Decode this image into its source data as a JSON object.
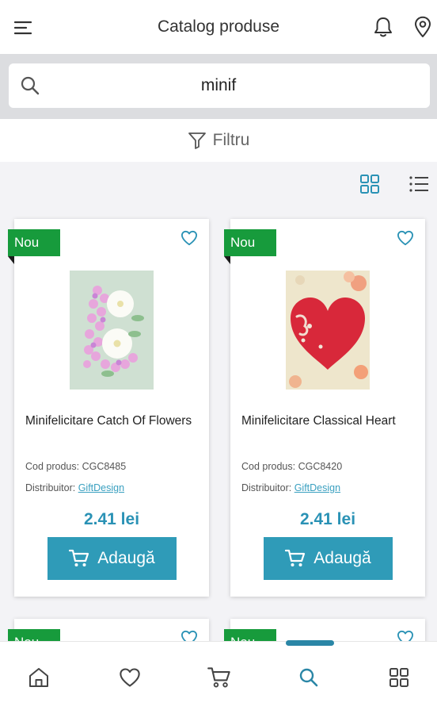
{
  "header": {
    "title": "Catalog produse",
    "menu_icon": "hamburger-menu-icon",
    "notifications_icon": "bell-icon",
    "location_icon": "map-pin-icon"
  },
  "search": {
    "value": "minif",
    "icon": "search-icon"
  },
  "filter": {
    "label": "Filtru",
    "icon": "funnel-icon"
  },
  "view_toggle": {
    "grid_icon": "grid-view-icon",
    "list_icon": "list-view-icon",
    "active": "grid"
  },
  "colors": {
    "accent": "#2f9bb8",
    "price": "#2a92b5",
    "new_badge": "#179b3c"
  },
  "products": [
    {
      "badge": "Nou",
      "name": "Minifelicitare Catch Of Flowers",
      "code": "Cod produs: CGC8485",
      "distributor_label": "Distribuitor: ",
      "distributor": "GiftDesign",
      "price": "2.41 lei",
      "add_label": "Adaugă"
    },
    {
      "badge": "Nou",
      "name": "Minifelicitare Classical Heart",
      "code": "Cod produs: CGC8420",
      "distributor_label": "Distribuitor: ",
      "distributor": "GiftDesign",
      "price": "2.41 lei",
      "add_label": "Adaugă"
    },
    {
      "badge": "Nou"
    },
    {
      "badge": "Nou"
    }
  ],
  "bottom_nav": {
    "items": [
      {
        "icon": "home-icon"
      },
      {
        "icon": "heart-icon"
      },
      {
        "icon": "cart-icon"
      },
      {
        "icon": "search-icon",
        "active": true
      },
      {
        "icon": "grid-icon"
      }
    ]
  }
}
